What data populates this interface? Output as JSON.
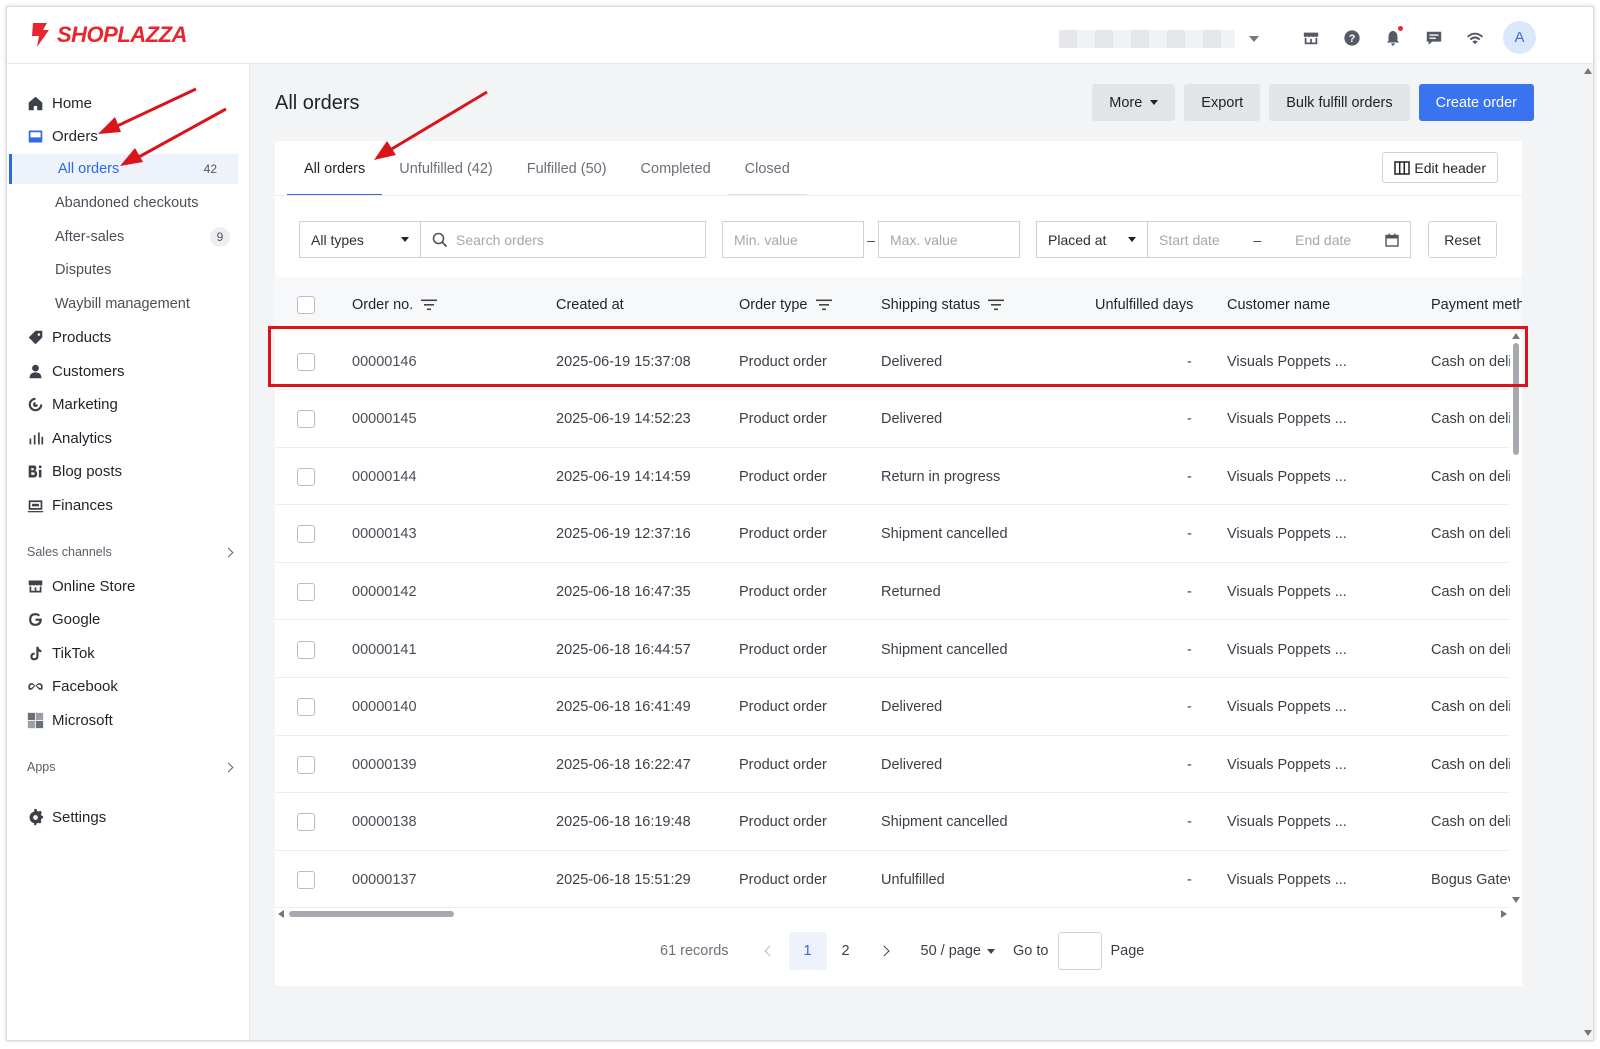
{
  "brand": {
    "name": "SHOPLAZZA",
    "color": "#e8262d"
  },
  "topbar": {
    "icons": [
      "store-icon",
      "help-icon",
      "bell-icon",
      "chat-icon",
      "wifi-icon"
    ],
    "avatar_initial": "A"
  },
  "sidebar": {
    "items": [
      {
        "label": "Home",
        "icon": "home-icon"
      },
      {
        "label": "Orders",
        "icon": "orders-icon"
      },
      {
        "label": "Products",
        "icon": "tag-icon"
      },
      {
        "label": "Customers",
        "icon": "person-icon"
      },
      {
        "label": "Marketing",
        "icon": "marketing-icon"
      },
      {
        "label": "Analytics",
        "icon": "bar-chart-icon"
      },
      {
        "label": "Blog posts",
        "icon": "blog-icon"
      },
      {
        "label": "Finances",
        "icon": "finance-icon"
      }
    ],
    "order_subitems": [
      {
        "label": "All orders",
        "badge": "42"
      },
      {
        "label": "Abandoned checkouts",
        "badge": ""
      },
      {
        "label": "After-sales",
        "badge": "9"
      },
      {
        "label": "Disputes",
        "badge": ""
      },
      {
        "label": "Waybill management",
        "badge": ""
      }
    ],
    "sales_channels_label": "Sales channels",
    "channels": [
      {
        "label": "Online Store",
        "icon": "store-icon"
      },
      {
        "label": "Google",
        "icon": "google-icon"
      },
      {
        "label": "TikTok",
        "icon": "tiktok-icon"
      },
      {
        "label": "Facebook",
        "icon": "meta-icon"
      },
      {
        "label": "Microsoft",
        "icon": "microsoft-icon"
      }
    ],
    "apps_label": "Apps",
    "settings_label": "Settings"
  },
  "main": {
    "title": "All orders",
    "actions": {
      "more": "More",
      "export": "Export",
      "bulk": "Bulk fulfill orders",
      "create": "Create order"
    },
    "tabs": [
      "All orders",
      "Unfulfilled (42)",
      "Fulfilled (50)",
      "Completed",
      "Closed"
    ],
    "edit_header": "Edit header",
    "filters": {
      "type": "All types",
      "search_placeholder": "Search orders",
      "min_placeholder": "Min. value",
      "max_placeholder": "Max. value",
      "date_field": "Placed at",
      "start_placeholder": "Start date",
      "end_placeholder": "End date",
      "reset": "Reset"
    },
    "columns": [
      "Order no.",
      "Created at",
      "Order type",
      "Shipping status",
      "Unfulfilled days",
      "Customer name",
      "Payment meth"
    ],
    "rows": [
      {
        "no": "00000146",
        "created": "2025-06-19 15:37:08",
        "type": "Product order",
        "status": "Delivered",
        "days": "-",
        "customer": "Visuals Poppets ...",
        "payment": "Cash on deli"
      },
      {
        "no": "00000145",
        "created": "2025-06-19 14:52:23",
        "type": "Product order",
        "status": "Delivered",
        "days": "-",
        "customer": "Visuals Poppets ...",
        "payment": "Cash on deli"
      },
      {
        "no": "00000144",
        "created": "2025-06-19 14:14:59",
        "type": "Product order",
        "status": "Return in progress",
        "days": "-",
        "customer": "Visuals Poppets ...",
        "payment": "Cash on deli"
      },
      {
        "no": "00000143",
        "created": "2025-06-19 12:37:16",
        "type": "Product order",
        "status": "Shipment cancelled",
        "days": "-",
        "customer": "Visuals Poppets ...",
        "payment": "Cash on deli"
      },
      {
        "no": "00000142",
        "created": "2025-06-18 16:47:35",
        "type": "Product order",
        "status": "Returned",
        "days": "-",
        "customer": "Visuals Poppets ...",
        "payment": "Cash on deli"
      },
      {
        "no": "00000141",
        "created": "2025-06-18 16:44:57",
        "type": "Product order",
        "status": "Shipment cancelled",
        "days": "-",
        "customer": "Visuals Poppets ...",
        "payment": "Cash on deli"
      },
      {
        "no": "00000140",
        "created": "2025-06-18 16:41:49",
        "type": "Product order",
        "status": "Delivered",
        "days": "-",
        "customer": "Visuals Poppets ...",
        "payment": "Cash on deli"
      },
      {
        "no": "00000139",
        "created": "2025-06-18 16:22:47",
        "type": "Product order",
        "status": "Delivered",
        "days": "-",
        "customer": "Visuals Poppets ...",
        "payment": "Cash on deli"
      },
      {
        "no": "00000138",
        "created": "2025-06-18 16:19:48",
        "type": "Product order",
        "status": "Shipment cancelled",
        "days": "-",
        "customer": "Visuals Poppets ...",
        "payment": "Cash on deli"
      },
      {
        "no": "00000137",
        "created": "2025-06-18 15:51:29",
        "type": "Product order",
        "status": "Unfulfilled",
        "days": "-",
        "customer": "Visuals Poppets ...",
        "payment": "Bogus Gatev"
      }
    ],
    "pagination": {
      "records": "61 records",
      "pages": [
        "1",
        "2"
      ],
      "page_size": "50 / page",
      "goto_label": "Go to",
      "page_label": "Page"
    }
  },
  "annotation": {
    "color": "#d9141c"
  }
}
